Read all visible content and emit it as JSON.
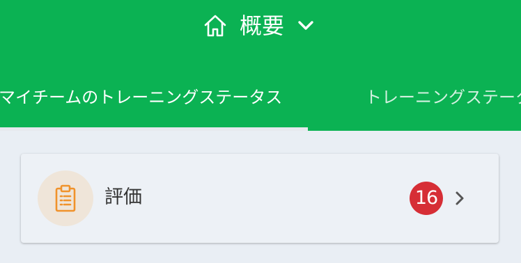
{
  "header": {
    "title": "概要",
    "title_icon": "home-icon",
    "dropdown_icon": "chevron-down-icon"
  },
  "tabs": [
    {
      "label": "マイチームのトレーニングステータス",
      "active": true
    },
    {
      "label": "トレーニングステータス",
      "active": false
    }
  ],
  "cards": [
    {
      "label": "評価",
      "icon": "clipboard-icon",
      "badge": "16",
      "arrow_icon": "chevron-right-icon"
    }
  ],
  "colors": {
    "header_bg": "#0bb253",
    "page_bg": "#e9eef4",
    "badge_bg": "#d62e36",
    "icon_accent": "#f0922b",
    "avatar_bg": "#efe5d9"
  }
}
